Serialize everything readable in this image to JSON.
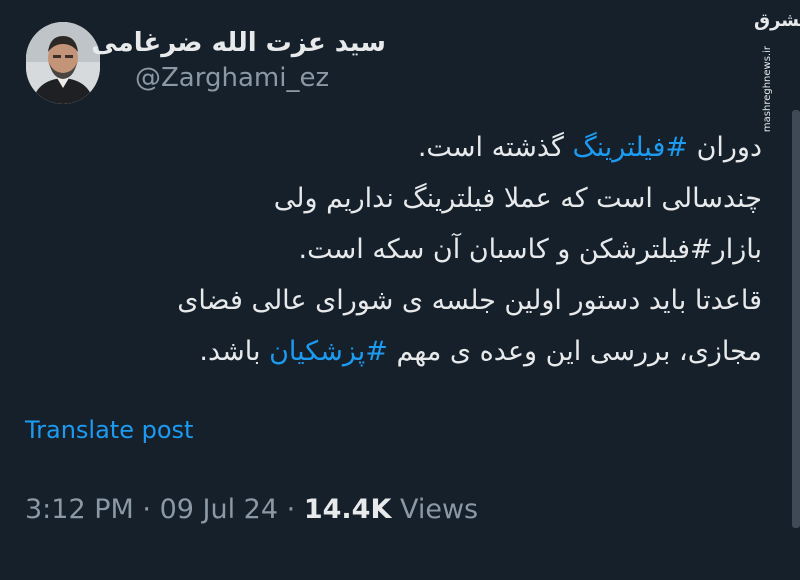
{
  "tweet": {
    "display_name": "سید عزت الله ضرغامی",
    "handle": "@Zarghami_ez",
    "lines": [
      {
        "before": "دوران ",
        "hashtag": "#فیلترینگ",
        "after": " گذشته است."
      },
      {
        "before": "چندسالی است که عملا فیلترینگ نداریم ولی",
        "hashtag": "",
        "after": ""
      },
      {
        "before": "بازار#فیلترشکن و کاسبان آن سکه است.",
        "hashtag": "",
        "after": ""
      },
      {
        "before": "قاعدتا باید دستور اولین جلسه ی شورای عالی فضای",
        "hashtag": "",
        "after": ""
      },
      {
        "before": "مجازی، بررسی این وعده ی مهم ",
        "hashtag": "#پزشکیان",
        "after": " باشد."
      }
    ],
    "translate_label": "Translate post",
    "time": "3:12 PM",
    "separator": "·",
    "date": "09 Jul 24",
    "views_count": "14.4K",
    "views_label": "Views"
  },
  "watermark": {
    "logo_text": "مشرق",
    "site": "mashreghnews.ir"
  },
  "colors": {
    "background": "#15202b",
    "text": "#e7e9ea",
    "secondary": "#8b98a5",
    "accent": "#1d9bf0"
  }
}
